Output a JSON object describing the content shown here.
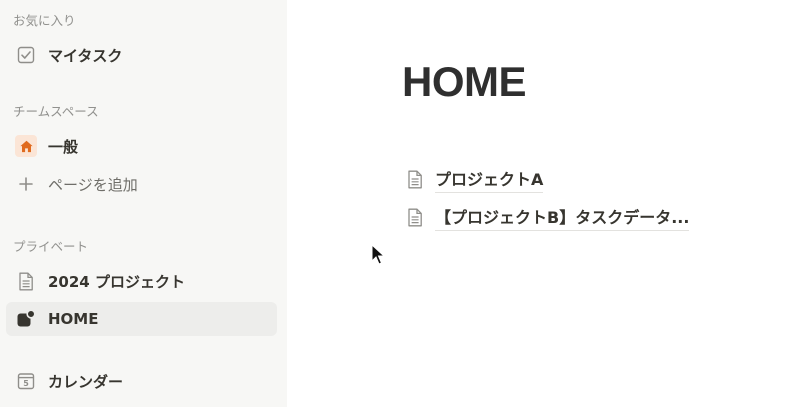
{
  "sidebar": {
    "favorites_label": "お気に入り",
    "favorites": [
      {
        "label": "マイタスク",
        "icon": "checkbox-icon"
      }
    ],
    "teamspace_label": "チームスペース",
    "teamspace": [
      {
        "label": "一般",
        "icon": "home-icon"
      }
    ],
    "add_page_label": "ページを追加",
    "private_label": "プライベート",
    "private": [
      {
        "label": "2024 プロジェクト",
        "icon": "document-icon"
      },
      {
        "label": "HOME",
        "icon": "shape-icon",
        "active": true
      }
    ],
    "calendar": {
      "label": "カレンダー",
      "icon": "calendar-icon",
      "day": "5"
    }
  },
  "main": {
    "title": "HOME",
    "links": [
      {
        "label": "プロジェクトA",
        "icon": "document-icon"
      },
      {
        "label": "【プロジェクトB】タスクデータ...",
        "icon": "document-icon"
      }
    ]
  },
  "colors": {
    "sidebar_bg": "#f7f7f5",
    "active_bg": "#ededeb",
    "home_icon_bg": "#fbe5d6",
    "home_icon": "#e06b1f"
  }
}
